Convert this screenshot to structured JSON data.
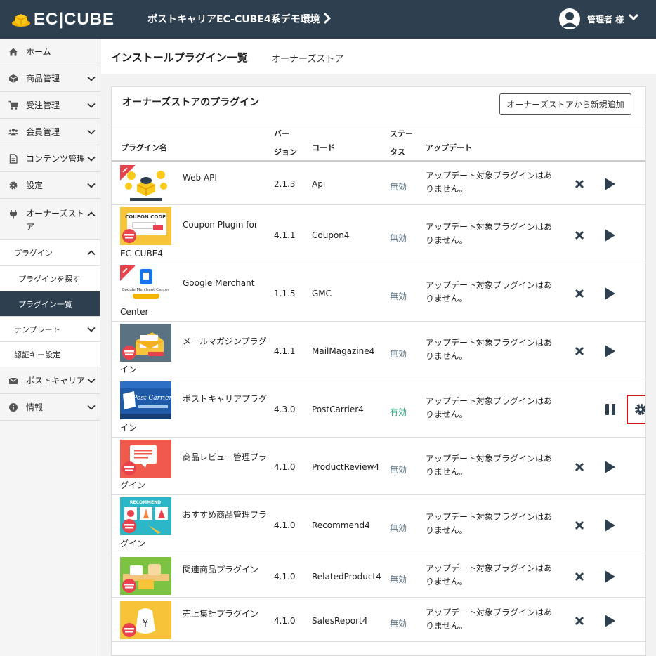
{
  "header": {
    "logo_text": "EC|CUBE",
    "shop_name": "ポストキャリアEC-CUBE4系デモ環境",
    "user_name": "管理者 様"
  },
  "sidebar": {
    "items": [
      {
        "label": "ホーム",
        "icon": "home-icon"
      },
      {
        "label": "商品管理",
        "icon": "box-icon"
      },
      {
        "label": "受注管理",
        "icon": "cart-icon"
      },
      {
        "label": "会員管理",
        "icon": "users-icon"
      },
      {
        "label": "コンテンツ管理",
        "icon": "file-icon"
      },
      {
        "label": "設定",
        "icon": "gear-icon"
      },
      {
        "label": "オーナーズストア",
        "icon": "plug-icon"
      }
    ],
    "sub_plugin": "プラグイン",
    "sub_find": "プラグインを探す",
    "sub_list": "プラグイン一覧",
    "sub_template": "テンプレート",
    "sub_auth": "認証キー設定",
    "post_carrier": "ポストキャリア",
    "info": "情報"
  },
  "page": {
    "title": "インストールプラグイン一覧",
    "subtitle": "オーナーズストア"
  },
  "card": {
    "title": "オーナーズストアのプラグイン",
    "add_button": "オーナーズストアから新規追加",
    "headers": {
      "name": "プラグイン名",
      "version_1": "バー",
      "version_2": "ジョン",
      "code": "コード",
      "status_1": "ステー",
      "status_2": "タス",
      "update": "アップデート"
    }
  },
  "update_text_1": "アップデート対象プラグインはあ",
  "update_text_2": "りません。",
  "plugins": [
    {
      "name_1": "Web API",
      "name_2": "",
      "version": "2.1.3",
      "code": "Api",
      "status": "無効",
      "thumb": "ec-cube-api",
      "new_badge": true
    },
    {
      "name_1": "Coupon Plugin for",
      "name_2": "EC-CUBE4",
      "version": "4.1.1",
      "code": "Coupon4",
      "status": "無効",
      "thumb": "coupon-code",
      "thumb_label": "COUPON CODE",
      "new_badge": false
    },
    {
      "name_1": "Google Merchant",
      "name_2": "Center",
      "version": "1.1.5",
      "code": "GMC",
      "status": "無効",
      "thumb": "google-merchant",
      "thumb_label": "Google Merchant Center",
      "new_badge": true
    },
    {
      "name_1": "メールマガジンプラグ",
      "name_2": "イン",
      "version": "4.1.1",
      "code": "MailMagazine4",
      "status": "無効",
      "thumb": "mail",
      "new_badge": false
    },
    {
      "name_1": "ポストキャリアプラグ",
      "name_2": "イン",
      "version": "4.3.0",
      "code": "PostCarrier4",
      "status": "有効",
      "thumb": "post-carrier",
      "thumb_label": "Post Carrier",
      "new_badge": false
    },
    {
      "name_1": "商品レビュー管理プラ",
      "name_2": "グイン",
      "version": "4.1.0",
      "code": "ProductReview4",
      "status": "無効",
      "thumb": "review",
      "new_badge": false
    },
    {
      "name_1": "おすすめ商品管理プラ",
      "name_2": "グイン",
      "version": "4.1.0",
      "code": "Recommend4",
      "status": "無効",
      "thumb": "recommend",
      "thumb_label": "RECOMMEND",
      "new_badge": false
    },
    {
      "name_1": "関連商品プラグイン",
      "name_2": "",
      "version": "4.1.0",
      "code": "RelatedProduct4",
      "status": "無効",
      "thumb": "related",
      "new_badge": false
    },
    {
      "name_1": "売上集計プラグイン",
      "name_2": "",
      "version": "4.1.0",
      "code": "SalesReport4",
      "status": "無効",
      "thumb": "sales",
      "new_badge": false
    }
  ],
  "colors": {
    "header_bg": "#2e3f4f",
    "status_active": "#2aa37a",
    "status_inactive": "#637989",
    "highlight": "#d0161b"
  }
}
